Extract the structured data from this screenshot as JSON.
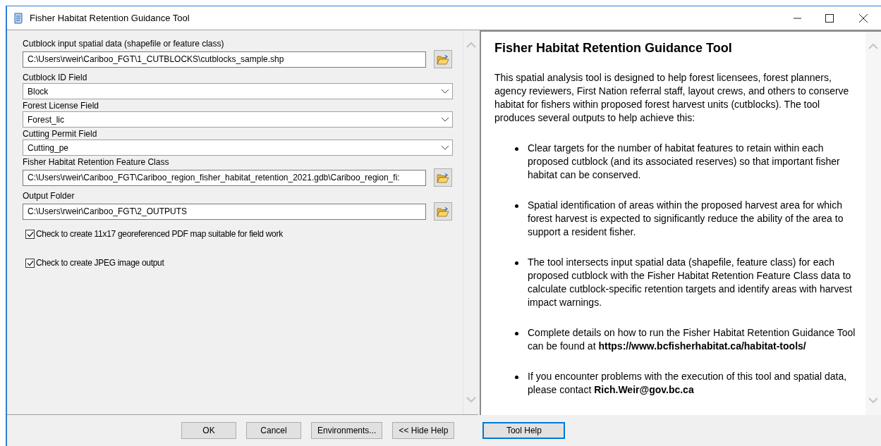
{
  "window": {
    "title": "Fisher Habitat Retention Guidance Tool"
  },
  "parameters": [
    {
      "kind": "path",
      "label": "Cutblock input spatial data (shapefile or feature class)",
      "value": "C:\\Users\\rweir\\Cariboo_FGT\\1_CUTBLOCKS\\cutblocks_sample.shp"
    },
    {
      "kind": "dropdown",
      "label": "Cutblock ID Field",
      "value": "Block"
    },
    {
      "kind": "dropdown",
      "label": "Forest License Field",
      "value": "Forest_lic"
    },
    {
      "kind": "dropdown",
      "label": "Cutting Permit Field",
      "value": "Cutting_pe"
    },
    {
      "kind": "path",
      "label": "Fisher Habitat Retention Feature Class",
      "value": "C:\\Users\\rweir\\Cariboo_FGT\\Cariboo_region_fisher_habitat_retention_2021.gdb\\Cariboo_region_fi:"
    },
    {
      "kind": "path",
      "label": "Output Folder",
      "value": "C:\\Users\\rweir\\Cariboo_FGT\\2_OUTPUTS"
    }
  ],
  "checkboxes": [
    {
      "label": "Check to create 11x17 georeferenced PDF map suitable for field work",
      "checked": true
    },
    {
      "label": "Check to create JPEG image output",
      "checked": true
    }
  ],
  "help": {
    "title": "Fisher Habitat Retention Guidance Tool",
    "intro": "This spatial analysis tool is designed to help forest licensees, forest planners, agency reviewers, First Nation referral staff, layout crews, and others to conserve habitat for fishers within proposed forest harvest units (cutblocks). The tool produces several outputs to help achieve this:",
    "bullets": [
      "Clear targets for the number of habitat features to retain within each proposed cutblock (and its associated reserves) so that important fisher habitat can be conserved.",
      "Spatial identification of areas within the proposed harvest area for which forest harvest is expected to significantly reduce the ability of the area to support a resident fisher.",
      "The tool intersects input spatial data (shapefile, feature class) for each proposed cutblock with the Fisher Habitat Retention Feature Class data to calculate cutblock-specific retention targets and identify areas with harvest impact warnings.",
      "Complete details on how to run the Fisher Habitat Retention Guidance Tool can be found at **https://www.bcfisherhabitat.ca/habitat-tools/**",
      "If you encounter problems with the execution of this tool and spatial data, please contact **Rich.Weir@gov.bc.ca**"
    ]
  },
  "buttons": [
    {
      "label": "OK",
      "focused": false
    },
    {
      "label": "Cancel",
      "focused": false
    },
    {
      "label": "Environments...",
      "focused": false
    },
    {
      "label": "<< Hide Help",
      "focused": false
    },
    {
      "label": "Tool Help",
      "focused": true
    }
  ]
}
